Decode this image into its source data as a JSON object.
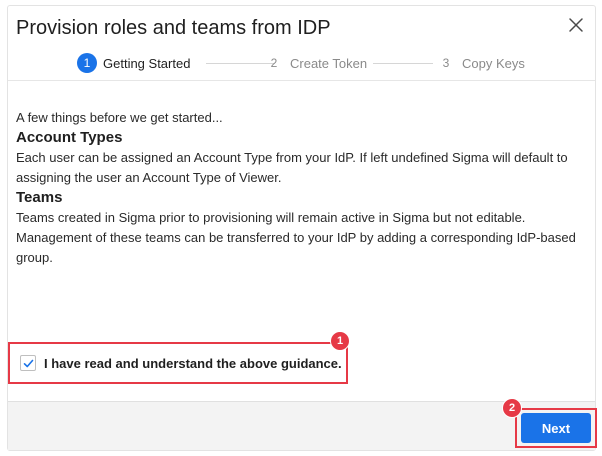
{
  "dialog": {
    "title": "Provision roles and teams from IDP",
    "close_icon": "close-icon"
  },
  "stepper": {
    "steps": [
      {
        "number": "1",
        "label": "Getting Started",
        "active": true
      },
      {
        "number": "2",
        "label": "Create Token",
        "active": false
      },
      {
        "number": "3",
        "label": "Copy Keys",
        "active": false
      }
    ]
  },
  "content": {
    "intro": "A few things before we get started...",
    "account_types": {
      "heading": "Account Types",
      "body": "Each user can be assigned an Account Type from your IdP. If left undefined Sigma will default to assigning the user an Account Type of Viewer."
    },
    "teams": {
      "heading": "Teams",
      "body": "Teams created in Sigma prior to provisioning will remain active in Sigma but not editable. Management of these teams can be transferred to your IdP by adding a corresponding IdP-based group."
    }
  },
  "acknowledge": {
    "checked": true,
    "label": "I have read and understand the above guidance."
  },
  "footer": {
    "next_label": "Next"
  },
  "annotations": {
    "badge1": "1",
    "badge2": "2"
  },
  "colors": {
    "accent": "#1a73e8",
    "highlight": "#e63946"
  }
}
